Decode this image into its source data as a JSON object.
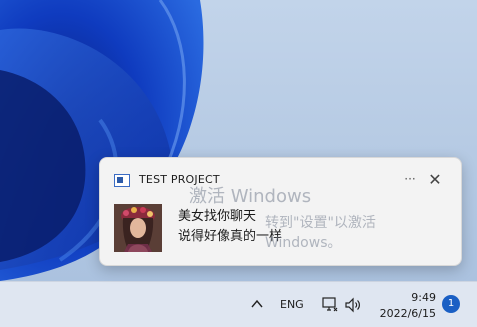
{
  "watermark": {
    "title": "激活 Windows",
    "subtitle": "转到\"设置\"以激活 Windows。"
  },
  "notification": {
    "app_name": "TEST PROJECT",
    "more_label": "···",
    "close_label": "✕",
    "title": "美女找你聊天",
    "text": "说得好像真的一样"
  },
  "taskbar": {
    "language": "ENG",
    "time": "9:49",
    "date": "2022/6/15",
    "notification_count": "1"
  },
  "colors": {
    "accent": "#1a5fc4",
    "wallpaper": "#b7cbe4",
    "taskbar": "#dfe6f1",
    "toast": "#f3f3f3"
  }
}
